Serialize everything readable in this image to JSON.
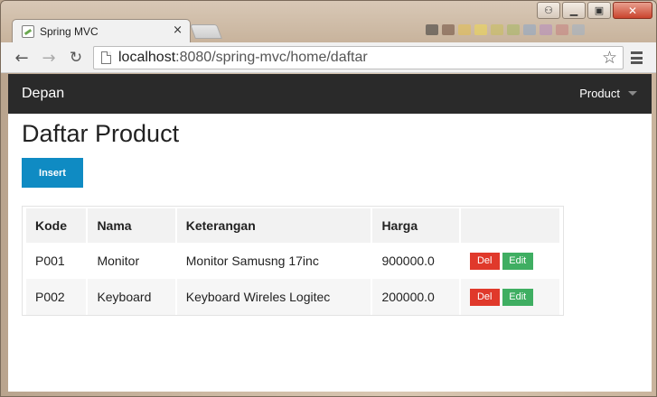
{
  "browser": {
    "tab_title": "Spring MVC",
    "tab_close": "×",
    "url_host": "localhost",
    "url_rest": ":8080/spring-mvc/home/daftar",
    "icons": [
      "back-arrow-icon",
      "forward-arrow-icon",
      "reload-icon",
      "page-icon",
      "star-icon",
      "menu-icon"
    ]
  },
  "window_controls": {
    "user": "⚇",
    "minimize": "▁",
    "maximize": "▣",
    "close": "✕"
  },
  "navbar": {
    "brand": "Depan",
    "product_menu": "Product"
  },
  "main": {
    "title": "Daftar Product",
    "insert_label": "Insert",
    "table": {
      "headers": [
        "Kode",
        "Nama",
        "Keterangan",
        "Harga",
        ""
      ],
      "rows": [
        {
          "kode": "P001",
          "nama": "Monitor",
          "keterangan": "Monitor Samusng 17inc",
          "harga": "900000.0",
          "del": "Del",
          "edit": "Edit"
        },
        {
          "kode": "P002",
          "nama": "Keyboard",
          "keterangan": "Keyboard Wireles Logitec",
          "harga": "200000.0",
          "del": "Del",
          "edit": "Edit"
        }
      ]
    }
  },
  "colors": {
    "navbar_bg": "#2a2a2a",
    "insert_btn": "#0f8bc3",
    "del_btn": "#e0392b",
    "edit_btn": "#3fae62"
  }
}
